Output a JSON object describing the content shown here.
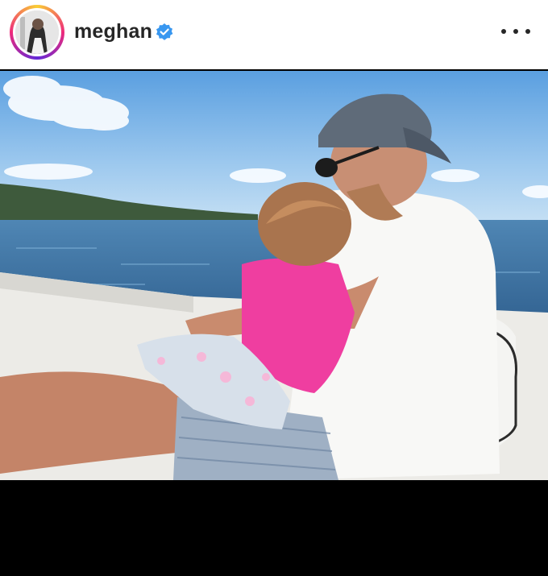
{
  "post": {
    "username": "meghan",
    "verified": true,
    "more_label": "More options"
  },
  "icons": {
    "verified": "verified-badge-icon",
    "more": "more-options-icon"
  },
  "colors": {
    "verified_blue": "#3897f0",
    "text": "#262626",
    "frame": "#000000"
  }
}
